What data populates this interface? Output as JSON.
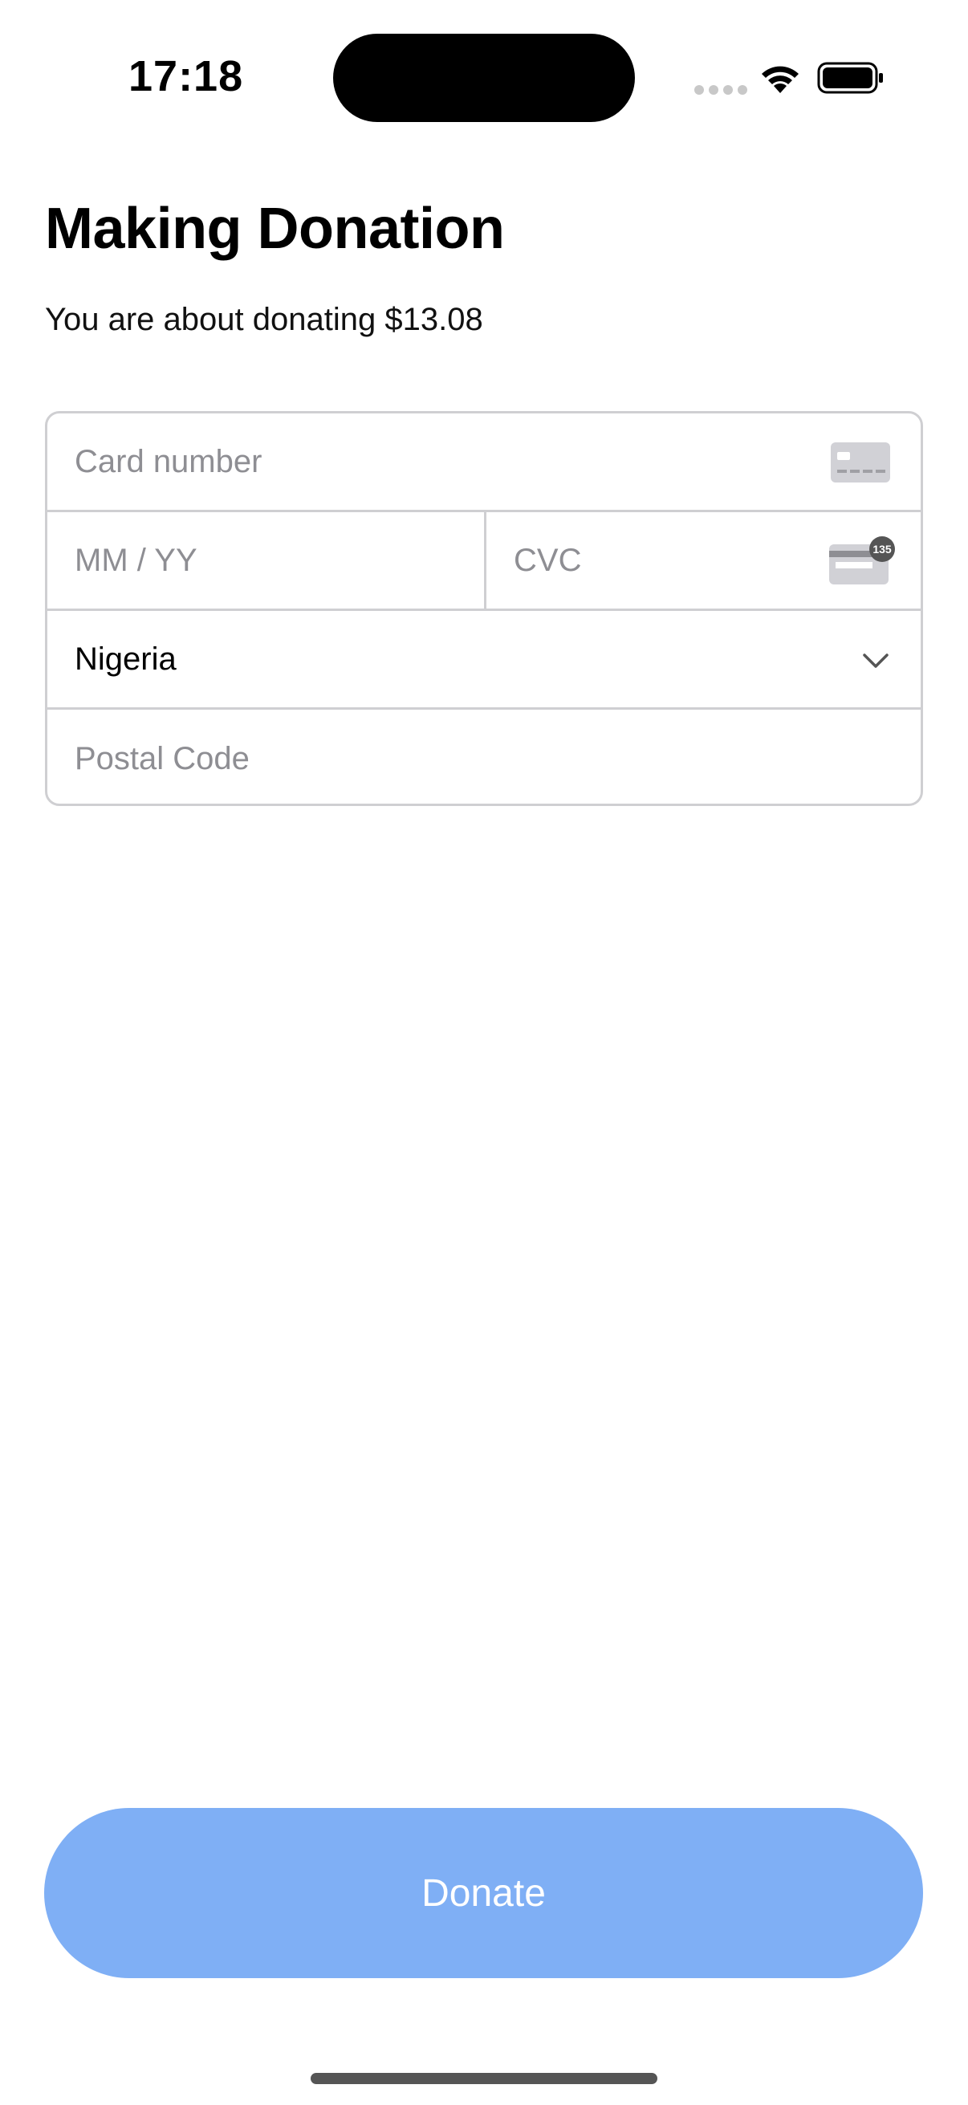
{
  "status_bar": {
    "time": "17:18",
    "icons": [
      "signal-dots-icon",
      "wifi-icon",
      "battery-icon"
    ]
  },
  "header": {
    "title": "Making Donation",
    "subtitle": "You are about donating $13.08"
  },
  "card_form": {
    "card_number_placeholder": "Card number",
    "expiry_placeholder": "MM / YY",
    "cvc_placeholder": "CVC",
    "cvc_badge": "135",
    "country_value": "Nigeria",
    "postal_code_placeholder": "Postal Code"
  },
  "actions": {
    "donate_label": "Donate"
  },
  "colors": {
    "accent": "#7FAFF5",
    "border": "#CFCFD2",
    "placeholder": "#8E8E93"
  }
}
